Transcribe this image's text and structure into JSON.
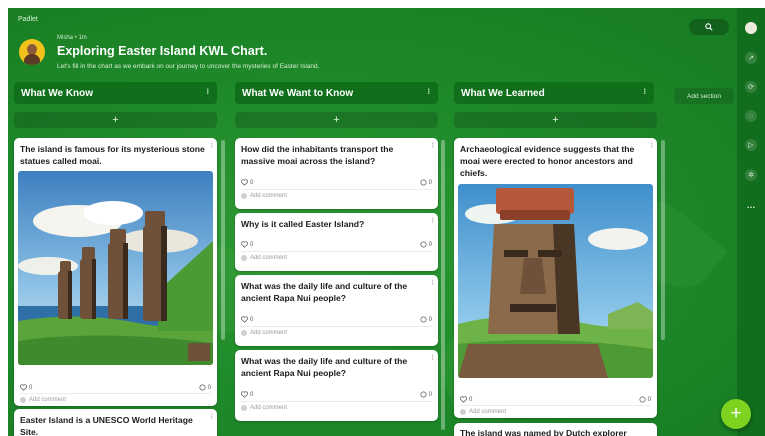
{
  "app": {
    "brand": "Padlet"
  },
  "header": {
    "author": "Misha • 1m",
    "title": "Exploring Easter Island KWL Chart.",
    "subtitle": "Let's fill in the chart as we embark on our journey to uncover the mysteries of Easter Island."
  },
  "toolbar": {
    "add_section_label": "Add section",
    "fab_label": "+"
  },
  "columns": [
    {
      "title": "What We Know",
      "add_label": "+",
      "posts": [
        {
          "text": "The island is famous for its mysterious stone statues called moai.",
          "likes": "0",
          "comments": "0",
          "add_comment": "Add comment"
        },
        {
          "text": "Easter Island is a UNESCO World Heritage Site."
        }
      ]
    },
    {
      "title": "What We Want to Know",
      "add_label": "+",
      "posts": [
        {
          "text": "How did the inhabitants transport the massive moai across the island?",
          "likes": "0",
          "comments": "0",
          "add_comment": "Add comment"
        },
        {
          "text": "Why is it called Easter Island?",
          "likes": "0",
          "comments": "0",
          "add_comment": "Add comment"
        },
        {
          "text": "What was the daily life and culture of the ancient Rapa Nui people?",
          "likes": "0",
          "comments": "0",
          "add_comment": "Add comment"
        },
        {
          "text": "What was the daily life and culture of the ancient Rapa Nui people?",
          "likes": "0",
          "comments": "0",
          "add_comment": "Add comment"
        }
      ]
    },
    {
      "title": "What We Learned",
      "add_label": "+",
      "posts": [
        {
          "text": "Archaeological evidence suggests that the moai were erected to honor ancestors and chiefs.",
          "likes": "0",
          "comments": "0",
          "add_comment": "Add comment"
        },
        {
          "text": "The island was named by Dutch explorer"
        }
      ]
    }
  ],
  "colors": {
    "background": "#1f8a2a",
    "header_band": "#0f6f1b",
    "fab": "#7ed321",
    "card": "#ffffff"
  },
  "icons": [
    "search-icon",
    "heart-icon",
    "comment-icon",
    "more-icon",
    "plus-icon"
  ]
}
